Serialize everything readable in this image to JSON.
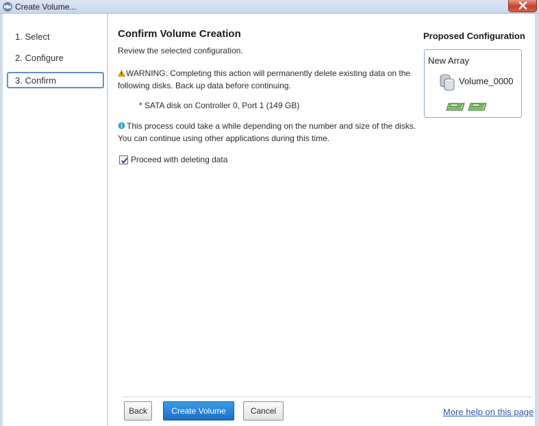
{
  "window": {
    "title": "Create Volume..."
  },
  "sidebar": {
    "steps": [
      {
        "label": "1. Select"
      },
      {
        "label": "2. Configure"
      },
      {
        "label": "3. Confirm",
        "active": true
      }
    ]
  },
  "main": {
    "heading": "Confirm Volume Creation",
    "subheading": "Review the selected configuration.",
    "warning_text": "WARNING: Completing this action will permanently delete existing data on the following disks. Back up data before continuing.",
    "disk_line": "* SATA disk on Controller 0, Port 1 (149 GB)",
    "info_text": "This process could take a while depending on the number and size of the disks. You can continue using other applications during this time.",
    "checkbox": {
      "label": "Proceed with deleting data",
      "checked": true
    }
  },
  "proposed": {
    "title": "Proposed Configuration",
    "array_label": "New Array",
    "volume_label": "Volume_0000",
    "disk_count": 2
  },
  "footer": {
    "back_label": "Back",
    "create_label": "Create Volume",
    "cancel_label": "Cancel",
    "help_link": "More help on this page"
  },
  "colors": {
    "accent": "#1a6fc6",
    "link": "#2c5aa8",
    "warning": "#e0b000",
    "info": "#3aa0c8",
    "disk_green": "#57b83e"
  },
  "icons": {
    "app": "app-icon",
    "close": "close-icon",
    "warning": "warning-icon",
    "info": "info-icon",
    "volume": "volume-icon",
    "disk": "disk-icon",
    "checkmark": "checkmark-icon"
  }
}
